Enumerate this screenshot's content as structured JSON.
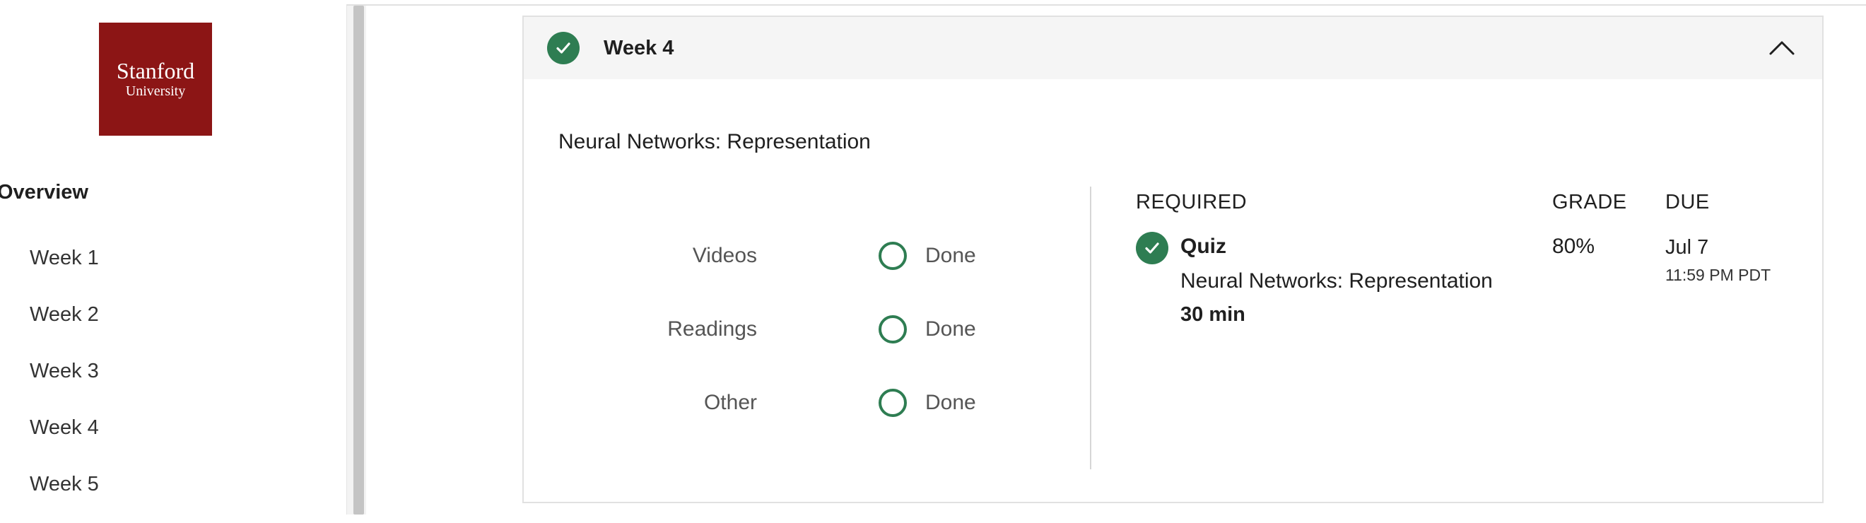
{
  "sidebar": {
    "logo": {
      "line1": "Stanford",
      "line2": "University"
    },
    "overview_label": "Overview",
    "items": [
      {
        "label": "Week 1"
      },
      {
        "label": "Week 2"
      },
      {
        "label": "Week 3"
      },
      {
        "label": "Week 4"
      },
      {
        "label": "Week 5"
      }
    ]
  },
  "week": {
    "title": "Week 4",
    "module_title": "Neural Networks: Representation",
    "progress": [
      {
        "label": "Videos",
        "status": "Done"
      },
      {
        "label": "Readings",
        "status": "Done"
      },
      {
        "label": "Other",
        "status": "Done"
      }
    ],
    "columns": {
      "required": "REQUIRED",
      "grade": "GRADE",
      "due": "DUE"
    },
    "item": {
      "title": "Quiz",
      "subtitle": "Neural Networks: Representation",
      "duration": "30 min",
      "grade": "80%",
      "due_date": "Jul 7",
      "due_time": "11:59 PM PDT"
    }
  },
  "colors": {
    "brand": "#8c1515",
    "success": "#2e7d52"
  },
  "icons": {
    "complete": "check-circle-icon",
    "collapse": "chevron-up-icon",
    "incomplete": "empty-circle-icon"
  }
}
